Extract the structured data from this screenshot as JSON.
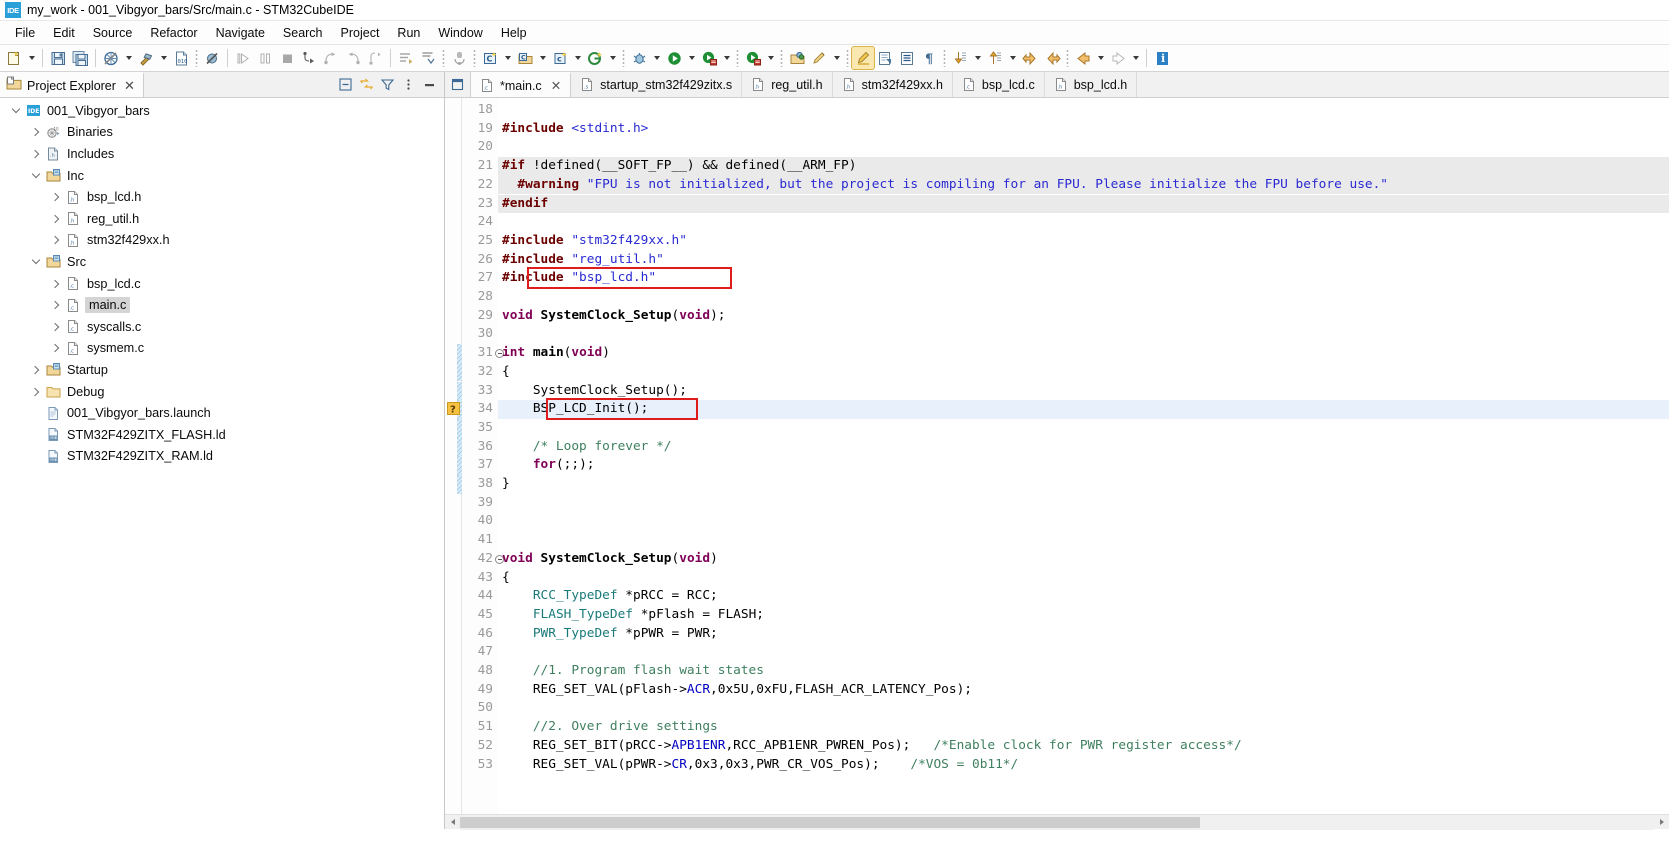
{
  "window": {
    "title": "my_work - 001_Vibgyor_bars/Src/main.c - STM32CubeIDE",
    "app_icon_text": "IDE"
  },
  "menubar": {
    "items": [
      "File",
      "Edit",
      "Source",
      "Refactor",
      "Navigate",
      "Search",
      "Project",
      "Run",
      "Window",
      "Help"
    ]
  },
  "toolbar": {
    "groups": [
      {
        "name": "new",
        "icons": [
          "new-file-icon",
          "dropdown-arrow"
        ]
      },
      {
        "name": "save",
        "icons": [
          "save-icon",
          "save-all-icon"
        ]
      },
      {
        "name": "build-cfg",
        "icons": [
          "build-settings-icon",
          "dropdown-arrow",
          "build-hammer-icon",
          "dropdown-arrow",
          "binary-icon"
        ]
      },
      {
        "name": "debug-skip",
        "icons": [
          "skip-breakpoints-icon"
        ]
      },
      {
        "name": "run-ctrl",
        "icons": [
          "resume-icon",
          "suspend-icon",
          "terminate-icon",
          "step-into-icon",
          "step-over-icon",
          "step-return-icon",
          "drop-to-frame-icon"
        ]
      },
      {
        "name": "nav",
        "icons": [
          "next-annotation-icon",
          "previous-annotation-icon",
          "external-tools-icon"
        ]
      },
      {
        "name": "new-elems",
        "icons": [
          "new-c-project-icon",
          "dropdown-arrow",
          "new-c-folder-icon",
          "dropdown-arrow",
          "new-c-file-icon",
          "dropdown-arrow",
          "new-wizard-icon",
          "dropdown-arrow"
        ]
      },
      {
        "name": "debug-run",
        "icons": [
          "debug-bug-icon",
          "dropdown-arrow",
          "run-icon",
          "dropdown-arrow",
          "run-config-icon",
          "dropdown-arrow",
          "debug-config-icon",
          "dropdown-arrow"
        ]
      },
      {
        "name": "edit-tools",
        "icons": [
          "open-type-icon",
          "pencil-icon",
          "dropdown-arrow"
        ]
      },
      {
        "name": "format",
        "icons": [
          "highlight-marker-icon",
          "block-comment-icon",
          "format-icon",
          "pilcrow-icon"
        ]
      },
      {
        "name": "members",
        "icons": [
          "next-member-icon",
          "dropdown-arrow",
          "previous-member-icon",
          "dropdown-arrow"
        ]
      },
      {
        "name": "history",
        "icons": [
          "back-edit-icon",
          "forward-edit-icon",
          "back-nav-icon",
          "dropdown-arrow",
          "forward-nav-icon",
          "dropdown-arrow"
        ]
      }
    ]
  },
  "explorer": {
    "tab_title": "Project Explorer",
    "tab_close": "✕",
    "tools": [
      "collapse-all-icon",
      "link-with-editor-icon",
      "view-filter-icon",
      "view-menu-icon",
      "minimize-icon"
    ],
    "tree": [
      {
        "label": "001_Vibgyor_bars",
        "depth": 0,
        "twist": "expanded",
        "icon": "project-icon",
        "selected": false
      },
      {
        "label": "Binaries",
        "depth": 1,
        "twist": "collapsed",
        "icon": "binaries-icon",
        "selected": false
      },
      {
        "label": "Includes",
        "depth": 1,
        "twist": "collapsed",
        "icon": "includes-icon",
        "selected": false
      },
      {
        "label": "Inc",
        "depth": 1,
        "twist": "expanded",
        "icon": "source-folder-icon",
        "selected": false
      },
      {
        "label": "bsp_lcd.h",
        "depth": 2,
        "twist": "collapsed",
        "icon": "header-file-icon",
        "selected": false
      },
      {
        "label": "reg_util.h",
        "depth": 2,
        "twist": "collapsed",
        "icon": "header-file-icon",
        "selected": false
      },
      {
        "label": "stm32f429xx.h",
        "depth": 2,
        "twist": "collapsed",
        "icon": "header-file-icon",
        "selected": false
      },
      {
        "label": "Src",
        "depth": 1,
        "twist": "expanded",
        "icon": "source-folder-icon",
        "selected": false
      },
      {
        "label": "bsp_lcd.c",
        "depth": 2,
        "twist": "collapsed",
        "icon": "c-file-icon",
        "selected": false
      },
      {
        "label": "main.c",
        "depth": 2,
        "twist": "collapsed",
        "icon": "c-file-icon",
        "selected": true
      },
      {
        "label": "syscalls.c",
        "depth": 2,
        "twist": "collapsed",
        "icon": "c-file-icon",
        "selected": false
      },
      {
        "label": "sysmem.c",
        "depth": 2,
        "twist": "collapsed",
        "icon": "c-file-icon",
        "selected": false
      },
      {
        "label": "Startup",
        "depth": 1,
        "twist": "collapsed",
        "icon": "source-folder-icon",
        "selected": false
      },
      {
        "label": "Debug",
        "depth": 1,
        "twist": "collapsed",
        "icon": "folder-icon",
        "selected": false
      },
      {
        "label": "001_Vibgyor_bars.launch",
        "depth": 1,
        "twist": "none",
        "icon": "launch-file-icon",
        "selected": false
      },
      {
        "label": "STM32F429ZITX_FLASH.ld",
        "depth": 1,
        "twist": "none",
        "icon": "linker-script-icon",
        "selected": false
      },
      {
        "label": "STM32F429ZITX_RAM.ld",
        "depth": 1,
        "twist": "none",
        "icon": "linker-script-icon",
        "selected": false
      }
    ]
  },
  "editor": {
    "minimize_icon": "restore-icon",
    "tabs": [
      {
        "label": "*main.c",
        "icon": "c-file-icon",
        "active": true,
        "closeable": true,
        "close": "✕"
      },
      {
        "label": "startup_stm32f429zitx.s",
        "icon": "asm-file-icon",
        "active": false,
        "closeable": false
      },
      {
        "label": "reg_util.h",
        "icon": "header-file-icon",
        "active": false,
        "closeable": false
      },
      {
        "label": "stm32f429xx.h",
        "icon": "header-file-icon",
        "active": false,
        "closeable": false
      },
      {
        "label": "bsp_lcd.c",
        "icon": "c-file-icon",
        "active": false,
        "closeable": false
      },
      {
        "label": "bsp_lcd.h",
        "icon": "header-file-icon",
        "active": false,
        "closeable": false
      }
    ],
    "first_line": 18,
    "current_line": 34,
    "lines": [
      {
        "n": 18,
        "tokens": []
      },
      {
        "n": 19,
        "tokens": [
          {
            "t": "#include ",
            "c": "t-pp"
          },
          {
            "t": "<stdint.h>",
            "c": "t-str"
          }
        ]
      },
      {
        "n": 20,
        "tokens": []
      },
      {
        "n": 21,
        "tokens": [
          {
            "t": "#if ",
            "c": "t-pp"
          },
          {
            "t": "!defined(__SOFT_FP__) && defined(__ARM_FP)",
            "c": "t-pl"
          }
        ],
        "shade": true
      },
      {
        "n": 22,
        "tokens": [
          {
            "t": "  #warning ",
            "c": "t-pp"
          },
          {
            "t": "\"FPU is not initialized, but the project is compiling for an FPU. Please initialize the FPU before use.\"",
            "c": "t-str"
          }
        ],
        "shade": true
      },
      {
        "n": 23,
        "tokens": [
          {
            "t": "#endif",
            "c": "t-pp"
          }
        ],
        "shade": true
      },
      {
        "n": 24,
        "tokens": []
      },
      {
        "n": 25,
        "tokens": [
          {
            "t": "#include ",
            "c": "t-pp"
          },
          {
            "t": "\"stm32f429xx.h\"",
            "c": "t-str"
          }
        ]
      },
      {
        "n": 26,
        "tokens": [
          {
            "t": "#include ",
            "c": "t-pp"
          },
          {
            "t": "\"reg_util.h\"",
            "c": "t-str"
          }
        ]
      },
      {
        "n": 27,
        "tokens": [
          {
            "t": "#include ",
            "c": "t-pp"
          },
          {
            "t": "\"bsp_lcd.h\"",
            "c": "t-str"
          }
        ]
      },
      {
        "n": 28,
        "tokens": []
      },
      {
        "n": 29,
        "tokens": [
          {
            "t": "void ",
            "c": "t-kw"
          },
          {
            "t": "SystemClock_Setup",
            "c": "t-fn"
          },
          {
            "t": "(",
            "c": "t-pl"
          },
          {
            "t": "void",
            "c": "t-kw"
          },
          {
            "t": ");",
            "c": "t-pl"
          }
        ]
      },
      {
        "n": 30,
        "tokens": []
      },
      {
        "n": 31,
        "tokens": [
          {
            "t": "int ",
            "c": "t-kw"
          },
          {
            "t": "main",
            "c": "t-fn"
          },
          {
            "t": "(",
            "c": "t-pl"
          },
          {
            "t": "void",
            "c": "t-kw"
          },
          {
            "t": ")",
            "c": "t-pl"
          }
        ],
        "fold": true,
        "occ": true
      },
      {
        "n": 32,
        "tokens": [
          {
            "t": "{",
            "c": "t-pl"
          }
        ],
        "occ": true
      },
      {
        "n": 33,
        "tokens": [
          {
            "t": "    SystemClock_Setup();",
            "c": "t-pl"
          }
        ],
        "occ": true
      },
      {
        "n": 34,
        "tokens": [
          {
            "t": "    BSP_LCD_Init();",
            "c": "t-pl"
          }
        ],
        "occ": true,
        "marker": "warning-marker-icon"
      },
      {
        "n": 35,
        "tokens": [],
        "occ": true
      },
      {
        "n": 36,
        "tokens": [
          {
            "t": "    /* Loop forever */",
            "c": "t-cmt"
          }
        ],
        "occ": true
      },
      {
        "n": 37,
        "tokens": [
          {
            "t": "    ",
            "c": "t-pl"
          },
          {
            "t": "for",
            "c": "t-kw"
          },
          {
            "t": "(;;);",
            "c": "t-pl"
          }
        ],
        "occ": true
      },
      {
        "n": 38,
        "tokens": [
          {
            "t": "}",
            "c": "t-pl"
          }
        ],
        "occ": true
      },
      {
        "n": 39,
        "tokens": []
      },
      {
        "n": 40,
        "tokens": []
      },
      {
        "n": 41,
        "tokens": []
      },
      {
        "n": 42,
        "tokens": [
          {
            "t": "void ",
            "c": "t-kw"
          },
          {
            "t": "SystemClock_Setup",
            "c": "t-fn"
          },
          {
            "t": "(",
            "c": "t-pl"
          },
          {
            "t": "void",
            "c": "t-kw"
          },
          {
            "t": ")",
            "c": "t-pl"
          }
        ],
        "fold": true
      },
      {
        "n": 43,
        "tokens": [
          {
            "t": "{",
            "c": "t-pl"
          }
        ]
      },
      {
        "n": 44,
        "tokens": [
          {
            "t": "    ",
            "c": "t-pl"
          },
          {
            "t": "RCC_TypeDef",
            "c": "t-type"
          },
          {
            "t": " *pRCC = RCC;",
            "c": "t-pl"
          }
        ]
      },
      {
        "n": 45,
        "tokens": [
          {
            "t": "    ",
            "c": "t-pl"
          },
          {
            "t": "FLASH_TypeDef",
            "c": "t-type"
          },
          {
            "t": " *pFlash = FLASH;",
            "c": "t-pl"
          }
        ]
      },
      {
        "n": 46,
        "tokens": [
          {
            "t": "    ",
            "c": "t-pl"
          },
          {
            "t": "PWR_TypeDef",
            "c": "t-type"
          },
          {
            "t": " *pPWR = PWR;",
            "c": "t-pl"
          }
        ]
      },
      {
        "n": 47,
        "tokens": []
      },
      {
        "n": 48,
        "tokens": [
          {
            "t": "    //1. Program flash wait states",
            "c": "t-cmt"
          }
        ]
      },
      {
        "n": 49,
        "tokens": [
          {
            "t": "    REG_SET_VAL(pFlash->",
            "c": "t-pl"
          },
          {
            "t": "ACR",
            "c": "t-fld"
          },
          {
            "t": ",0x5U,0xFU,FLASH_ACR_LATENCY_Pos);",
            "c": "t-pl"
          }
        ]
      },
      {
        "n": 50,
        "tokens": []
      },
      {
        "n": 51,
        "tokens": [
          {
            "t": "    //2. Over drive settings",
            "c": "t-cmt"
          }
        ]
      },
      {
        "n": 52,
        "tokens": [
          {
            "t": "    REG_SET_BIT(pRCC->",
            "c": "t-pl"
          },
          {
            "t": "APB1ENR",
            "c": "t-fld"
          },
          {
            "t": ",RCC_APB1ENR_PWREN_Pos);   ",
            "c": "t-pl"
          },
          {
            "t": "/*Enable clock for PWR register access*/",
            "c": "t-cmt"
          }
        ]
      },
      {
        "n": 53,
        "tokens": [
          {
            "t": "    REG_SET_VAL(pPWR->",
            "c": "t-pl"
          },
          {
            "t": "CR",
            "c": "t-fld"
          },
          {
            "t": ",0x3,0x3,PWR_CR_VOS_Pos);    ",
            "c": "t-pl"
          },
          {
            "t": "/*VOS = 0b11*/",
            "c": "t-cmt"
          }
        ]
      }
    ],
    "annotations": [
      {
        "name": "include-bsp-lcd-highlight",
        "color": "#e01b1b",
        "line": 27
      },
      {
        "name": "bsp-lcd-init-highlight",
        "color": "#e01b1b",
        "line": 34
      }
    ]
  },
  "scrollbar": {
    "left_arrow": "scroll-left-arrow",
    "right_arrow": "scroll-right-arrow"
  },
  "colors": {
    "accent": "#2b9fd8",
    "annotation_red": "#e01b1b",
    "preprocessor": "#6c0000",
    "string": "#2a2ad2",
    "keyword": "#7f0055",
    "comment": "#3f7f5f",
    "type": "#1a7a7a",
    "field": "#0000c0",
    "current_line_bg": "#e8f0fb"
  }
}
